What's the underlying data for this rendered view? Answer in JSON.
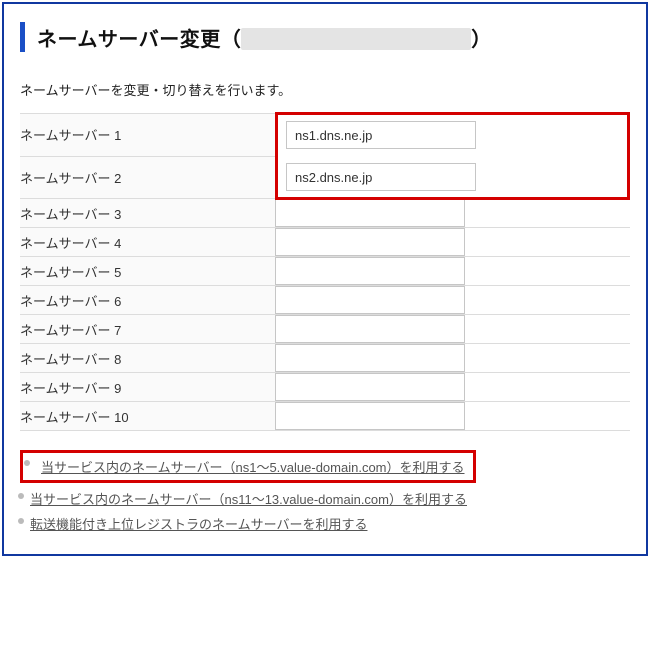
{
  "title": {
    "prefix": "ネームサーバー変更（",
    "suffix": "）"
  },
  "description": "ネームサーバーを変更・切り替えを行います。",
  "rows": [
    {
      "label": "ネームサーバー 1",
      "value": "ns1.dns.ne.jp"
    },
    {
      "label": "ネームサーバー 2",
      "value": "ns2.dns.ne.jp"
    },
    {
      "label": "ネームサーバー 3",
      "value": ""
    },
    {
      "label": "ネームサーバー 4",
      "value": ""
    },
    {
      "label": "ネームサーバー 5",
      "value": ""
    },
    {
      "label": "ネームサーバー 6",
      "value": ""
    },
    {
      "label": "ネームサーバー 7",
      "value": ""
    },
    {
      "label": "ネームサーバー 8",
      "value": ""
    },
    {
      "label": "ネームサーバー 9",
      "value": ""
    },
    {
      "label": "ネームサーバー 10",
      "value": ""
    }
  ],
  "links": [
    {
      "text": "当サービス内のネームサーバー（ns1〜5.value-domain.com）を利用する",
      "highlight": true
    },
    {
      "text": "当サービス内のネームサーバー（ns11〜13.value-domain.com）を利用する",
      "highlight": false
    },
    {
      "text": "転送機能付き上位レジストラのネームサーバーを利用する",
      "highlight": false
    }
  ]
}
